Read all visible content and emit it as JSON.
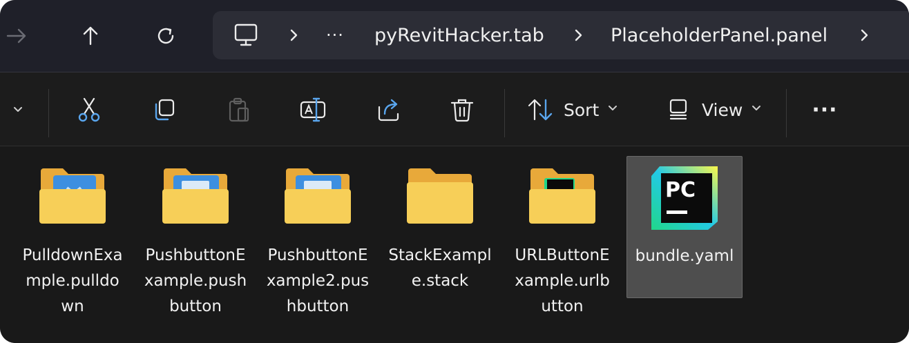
{
  "nav": {
    "forward_icon": "arrow-right-icon",
    "up_icon": "arrow-up-icon",
    "refresh_icon": "refresh-icon"
  },
  "address": {
    "pc_icon": "monitor-icon",
    "overflow_label": "···",
    "segments": [
      "pyRevitHacker.tab",
      "PlaceholderPanel.panel"
    ]
  },
  "commands": {
    "sort_label": "Sort",
    "view_label": "View",
    "more_label": "···",
    "icons": [
      "scissors-icon",
      "copy-icon",
      "paste-icon",
      "rename-icon",
      "share-icon",
      "trash-icon",
      "sort-icon",
      "view-icon"
    ]
  },
  "files": [
    {
      "name": "PulldownExample.pulldown",
      "type": "folder"
    },
    {
      "name": "PushbuttonExample.pushbutton",
      "type": "folder"
    },
    {
      "name": "PushbuttonExample2.pushbutton",
      "type": "folder"
    },
    {
      "name": "StackExample.stack",
      "type": "folder"
    },
    {
      "name": "URLButtonExample.urlbutton",
      "type": "folder"
    },
    {
      "name": "bundle.yaml",
      "type": "file",
      "selected": true
    }
  ],
  "colors": {
    "accent_blue": "#3d8fe0",
    "folder_yellow": "#f5c84c",
    "selection": "#4e4e4e"
  }
}
